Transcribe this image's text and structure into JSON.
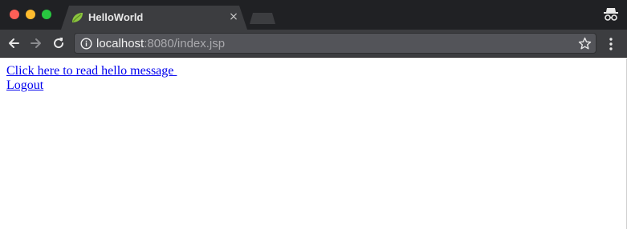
{
  "window": {
    "traffic_lights": [
      "close",
      "minimize",
      "maximize"
    ],
    "colors": {
      "close": "#fd5f57",
      "minimize": "#febc2e",
      "maximize": "#28c840"
    }
  },
  "tab": {
    "title": "HelloWorld",
    "favicon": "spring-leaf-icon",
    "close_glyph": "×"
  },
  "toolbar": {
    "back_icon": "back-arrow-icon",
    "forward_icon": "forward-arrow-icon",
    "reload_icon": "reload-icon",
    "info_icon": "info-icon",
    "bookmark_icon": "star-icon",
    "menu_icon": "kebab-menu-icon",
    "incognito_icon": "incognito-icon"
  },
  "address_bar": {
    "host": "localhost",
    "rest": ":8080/index.jsp"
  },
  "page": {
    "links": [
      {
        "label": "Click here to read hello message "
      },
      {
        "label": "Logout"
      }
    ]
  }
}
